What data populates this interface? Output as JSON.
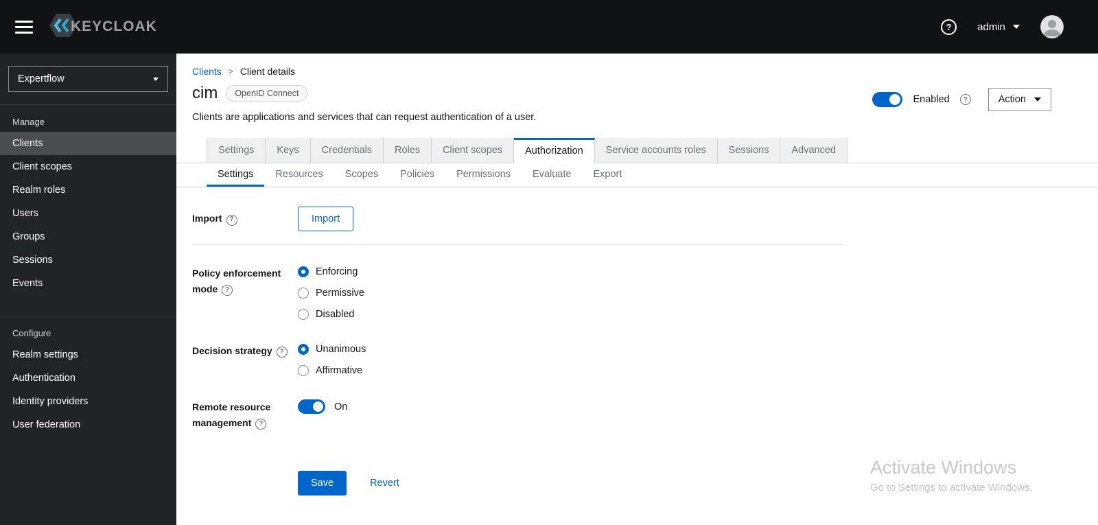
{
  "icons": {
    "help": "?",
    "breadcrumb_sep": ">"
  },
  "colors": {
    "accent": "#0066cc",
    "link": "#0066cc",
    "header_bg": "#101214",
    "sidebar_bg": "#212427",
    "sidebar_active_bg": "#4a4d50",
    "tab_inactive_bg": "#f0f0f0",
    "border": "#d2d2d2",
    "logo_cyan": "#45c6e8"
  },
  "header": {
    "brand": "KEYCLOAK",
    "user": "admin"
  },
  "sidebar": {
    "realm": "Expertflow",
    "active_item": "Clients",
    "groups": [
      {
        "label": "Manage",
        "items": [
          {
            "label": "Clients"
          },
          {
            "label": "Client scopes"
          },
          {
            "label": "Realm roles"
          },
          {
            "label": "Users"
          },
          {
            "label": "Groups"
          },
          {
            "label": "Sessions"
          },
          {
            "label": "Events"
          }
        ]
      },
      {
        "label": "Configure",
        "items": [
          {
            "label": "Realm settings"
          },
          {
            "label": "Authentication"
          },
          {
            "label": "Identity providers"
          },
          {
            "label": "User federation"
          }
        ]
      }
    ]
  },
  "breadcrumb": {
    "parent": "Clients",
    "current": "Client details"
  },
  "client": {
    "name": "cim",
    "protocol": "OpenID Connect",
    "description": "Clients are applications and services that can request authentication of a user.",
    "enabled_label": "Enabled",
    "enabled": true,
    "action_label": "Action"
  },
  "tabs": {
    "active": "Authorization",
    "items": [
      "Settings",
      "Keys",
      "Credentials",
      "Roles",
      "Client scopes",
      "Authorization",
      "Service accounts roles",
      "Sessions",
      "Advanced"
    ]
  },
  "subtabs": {
    "active": "Settings",
    "items": [
      "Settings",
      "Resources",
      "Scopes",
      "Policies",
      "Permissions",
      "Evaluate",
      "Export"
    ]
  },
  "form": {
    "import": {
      "label": "Import",
      "button_label": "Import"
    },
    "policy_enforcement_mode": {
      "label": "Policy enforcement mode",
      "selected": "Enforcing",
      "options": [
        "Enforcing",
        "Permissive",
        "Disabled"
      ]
    },
    "decision_strategy": {
      "label": "Decision strategy",
      "selected": "Unanimous",
      "options": [
        "Unanimous",
        "Affirmative"
      ]
    },
    "remote_resource_management": {
      "label": "Remote resource management",
      "enabled": true,
      "state_label": "On"
    },
    "actions": {
      "save_label": "Save",
      "revert_label": "Revert"
    }
  },
  "watermark": {
    "line1": "Activate Windows",
    "line2": "Go to Settings to activate Windows."
  }
}
